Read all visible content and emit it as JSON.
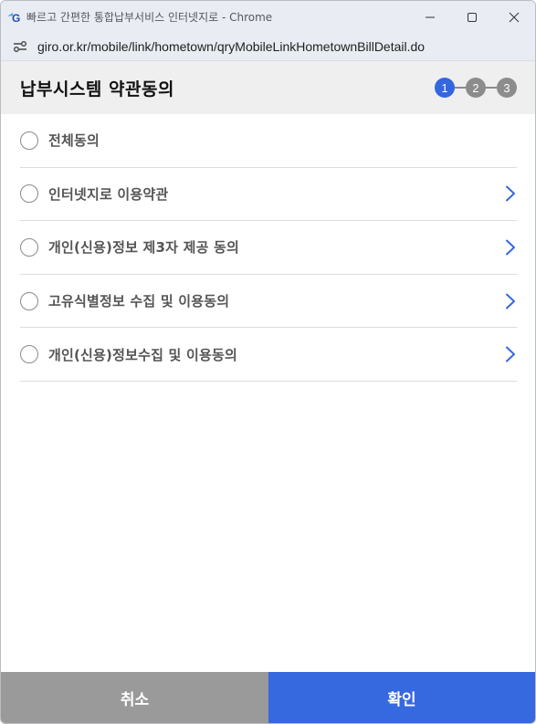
{
  "window": {
    "title": "빠르고 간편한 통합납부서비스 인터넷지로 - Chrome"
  },
  "address_bar": {
    "url": "giro.or.kr/mobile/link/hometown/qryMobileLinkHometownBillDetail.do"
  },
  "header": {
    "title": "납부시스템 약관동의",
    "steps": [
      {
        "label": "1",
        "state": "active"
      },
      {
        "label": "2",
        "state": "inactive"
      },
      {
        "label": "3",
        "state": "inactive"
      }
    ]
  },
  "agreements": [
    {
      "label": "전체동의",
      "has_detail": false
    },
    {
      "label": "인터넷지로 이용약관",
      "has_detail": true
    },
    {
      "label": "개인(신용)정보 제3자 제공 동의",
      "has_detail": true
    },
    {
      "label": "고유식별정보 수집 및 이용동의",
      "has_detail": true
    },
    {
      "label": "개인(신용)정보수집 및 이용동의",
      "has_detail": true
    }
  ],
  "buttons": {
    "cancel_label": "취소",
    "confirm_label": "확인"
  },
  "colors": {
    "accent": "#3668e0",
    "cancel": "#9a9a9a",
    "step_inactive": "#8c8c8c"
  }
}
